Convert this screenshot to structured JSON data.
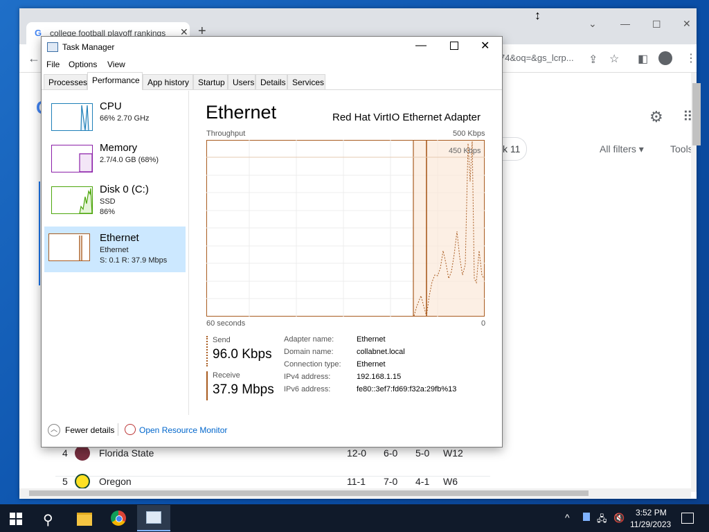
{
  "chrome": {
    "tab_title": "college football playoff rankings",
    "url_tail": "74&oq=&gs_lcrp...",
    "filters": "All filters",
    "tools": "Tools",
    "chip_tail": "k 11",
    "rows": [
      {
        "rank": "4",
        "team": "Florida State",
        "c1": "12-0",
        "c2": "6-0",
        "c3": "5-0",
        "c4": "W12",
        "logo_color": "#782f40"
      },
      {
        "rank": "5",
        "team": "Oregon",
        "c1": "11-1",
        "c2": "7-0",
        "c3": "4-1",
        "c4": "W6",
        "logo_color": "#fee123"
      }
    ]
  },
  "taskmanager": {
    "title": "Task Manager",
    "menu": [
      "File",
      "Options",
      "View"
    ],
    "tabs": [
      "Processes",
      "Performance",
      "App history",
      "Startup",
      "Users",
      "Details",
      "Services"
    ],
    "active_tab": "Performance",
    "resources": [
      {
        "name": "CPU",
        "line1": "66%  2.70 GHz",
        "line2": "",
        "color": "#1e7fb8"
      },
      {
        "name": "Memory",
        "line1": "2.7/4.0 GB (68%)",
        "line2": "",
        "color": "#8b1fa8"
      },
      {
        "name": "Disk 0 (C:)",
        "line1": "SSD",
        "line2": "86%",
        "color": "#4da60c"
      },
      {
        "name": "Ethernet",
        "line1": "Ethernet",
        "line2": "S: 0.1  R: 37.9 Mbps",
        "color": "#a85a1e"
      }
    ],
    "detail": {
      "title": "Ethernet",
      "adapter": "Red Hat VirtIO Ethernet Adapter",
      "throughput_label": "Throughput",
      "max_label": "500 Kbps",
      "scale_label": "450 Kbps",
      "x_left": "60 seconds",
      "x_right": "0",
      "send_label": "Send",
      "send_value": "96.0 Kbps",
      "recv_label": "Receive",
      "recv_value": "37.9 Mbps",
      "info": [
        {
          "k": "Adapter name:",
          "v": "Ethernet"
        },
        {
          "k": "Domain name:",
          "v": "collabnet.local"
        },
        {
          "k": "Connection type:",
          "v": "Ethernet"
        },
        {
          "k": "IPv4 address:",
          "v": "192.168.1.15"
        },
        {
          "k": "IPv6 address:",
          "v": "fe80::3ef7:fd69:f32a:29fb%13"
        }
      ]
    },
    "footer": {
      "fewer": "Fewer details",
      "monitor": "Open Resource Monitor"
    }
  },
  "taskbar": {
    "time": "3:52 PM",
    "date": "11/29/2023"
  }
}
